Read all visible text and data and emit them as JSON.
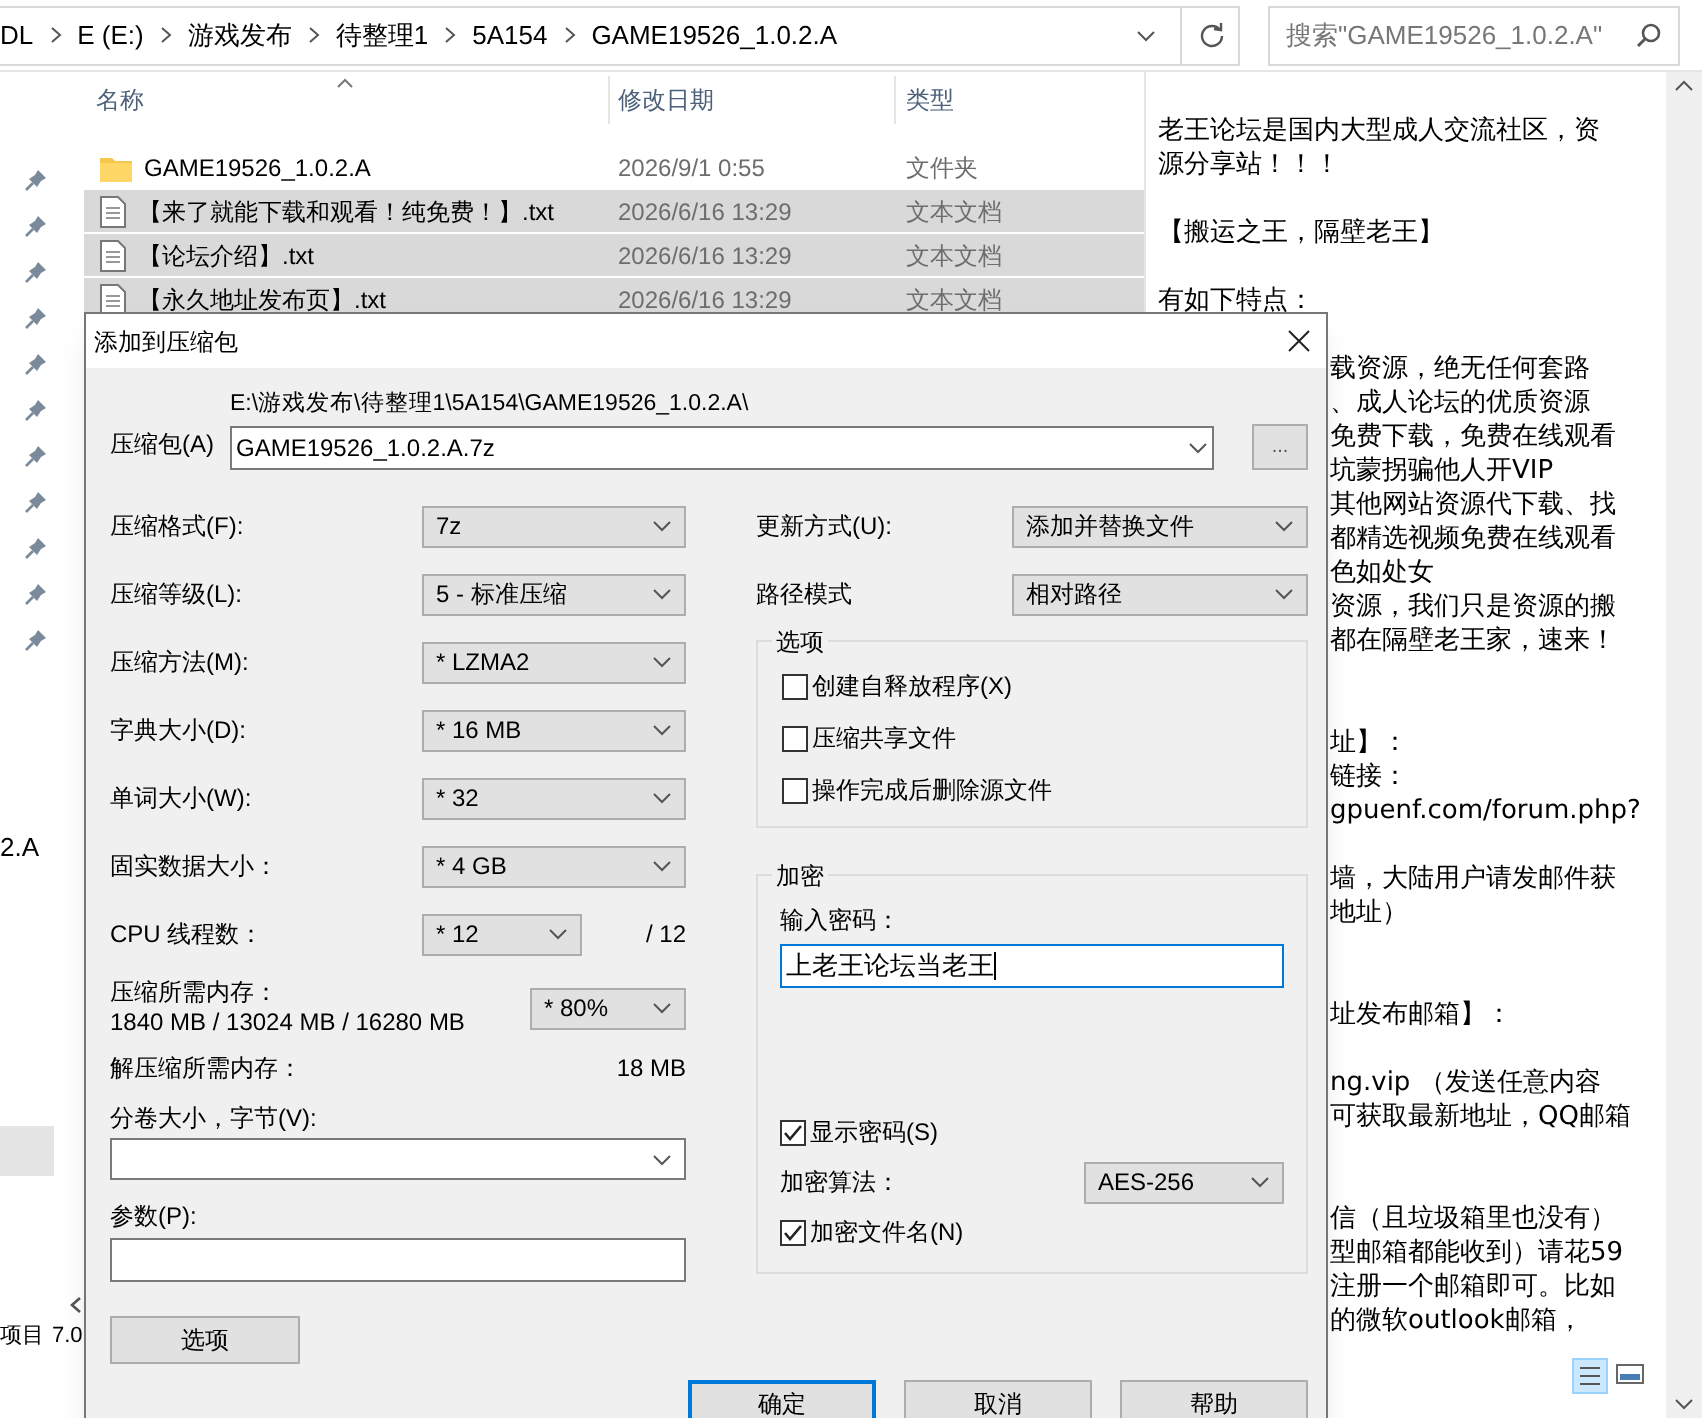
{
  "address_bar": {
    "crumbs": [
      "DL",
      "E (E:)",
      "游戏发布",
      "待整理1",
      "5A154",
      "GAME19526_1.0.2.A"
    ],
    "search_placeholder": "搜索\"GAME19526_1.0.2.A\""
  },
  "nav_pane": {
    "fragment": "2.A"
  },
  "file_list": {
    "columns": [
      "名称",
      "修改日期",
      "类型"
    ],
    "rows": [
      {
        "kind": "folder",
        "name": "GAME19526_1.0.2.A",
        "date": "2026/9/1 0:55",
        "type": "文件夹",
        "selected": false
      },
      {
        "kind": "text",
        "name": "【来了就能下载和观看！纯免费！】.txt",
        "date": "2026/6/16 13:29",
        "type": "文本文档",
        "selected": true
      },
      {
        "kind": "text",
        "name": "【论坛介绍】.txt",
        "date": "2026/6/16 13:29",
        "type": "文本文档",
        "selected": true
      },
      {
        "kind": "text",
        "name": "【永久地址发布页】.txt",
        "date": "2026/6/16 13:29",
        "type": "文本文档",
        "selected": true
      }
    ]
  },
  "status_bar": {
    "items": "项目",
    "size": "7.0"
  },
  "preview": {
    "top_paragraphs": [
      [
        "老王论坛是国内大型成人交流社区，资",
        "源分享站！！！"
      ],
      [
        "【搬运之王，隔壁老王】"
      ],
      [
        "有如下特点："
      ]
    ],
    "side_sections": [
      [
        [
          "载资源，绝无任何套路",
          "、成人论坛的优质资源",
          "免费下载，免费在线观看",
          "坑蒙拐骗他人开VIP",
          "其他网站资源代下载、找",
          "都精选视频免费在线观看",
          "色如处女",
          "资源，我们只是资源的搬",
          "都在隔壁老王家，速来！"
        ]
      ],
      [
        [
          "址】：",
          "链接：",
          "gpuenf.com/forum.php?"
        ],
        [
          "墙，大陆用户请发邮件获",
          "地址）"
        ]
      ],
      [
        [
          "址发布邮箱】："
        ],
        [
          "ng.vip  （发送任意内容",
          "可获取最新地址，QQ邮箱"
        ]
      ],
      [
        [
          "信（且垃圾箱里也没有）",
          "型邮箱都能收到）请花59",
          "注册一个邮箱即可。比如",
          "的微软outlook邮箱，"
        ]
      ]
    ]
  },
  "dialog": {
    "title": "添加到压缩包",
    "archive_label": "压缩包(A)",
    "archive_path": "E:\\游戏发布\\待整理1\\5A154\\GAME19526_1.0.2.A\\",
    "archive_name": "GAME19526_1.0.2.A.7z",
    "browse_button": "...",
    "left_fields": [
      {
        "kind": "select",
        "label": "压缩格式(F):",
        "value": "7z"
      },
      {
        "kind": "select",
        "label": "压缩等级(L):",
        "value": "5 - 标准压缩"
      },
      {
        "kind": "select",
        "label": "压缩方法(M):",
        "value": "* LZMA2"
      },
      {
        "kind": "select",
        "label": "字典大小(D):",
        "value": "* 16 MB"
      },
      {
        "kind": "select",
        "label": "单词大小(W):",
        "value": "* 32"
      },
      {
        "kind": "select",
        "label": "固实数据大小：",
        "value": "* 4 GB"
      },
      {
        "kind": "threads",
        "label": "CPU 线程数：",
        "value": "* 12",
        "total": "/ 12"
      },
      {
        "kind": "memory",
        "label": "压缩所需内存：",
        "detail": "1840 MB / 13024 MB / 16280 MB",
        "value": "* 80%"
      },
      {
        "kind": "readout",
        "label": "解压缩所需内存：",
        "value": "18 MB"
      }
    ],
    "volume_label": "分卷大小，字节(V):",
    "params_label": "参数(P):",
    "options_button": "选项",
    "update_mode": {
      "label": "更新方式(U):",
      "value": "添加并替换文件"
    },
    "path_mode": {
      "label": "路径模式",
      "value": "相对路径"
    },
    "options_group": {
      "title": "选项",
      "checkboxes": [
        {
          "label": "创建自释放程序(X)",
          "checked": false
        },
        {
          "label": "压缩共享文件",
          "checked": false
        },
        {
          "label": "操作完成后删除源文件",
          "checked": false
        }
      ]
    },
    "encryption": {
      "title": "加密",
      "password_label": "输入密码：",
      "password_value": "上老王论坛当老王",
      "show_password": {
        "label": "显示密码(S)",
        "checked": true
      },
      "method_label": "加密算法：",
      "method_value": "AES-256",
      "encrypt_names": {
        "label": "加密文件名(N)",
        "checked": true
      }
    },
    "buttons": [
      {
        "label": "确定",
        "default": true
      },
      {
        "label": "取消",
        "default": false
      },
      {
        "label": "帮助",
        "default": false
      }
    ]
  }
}
